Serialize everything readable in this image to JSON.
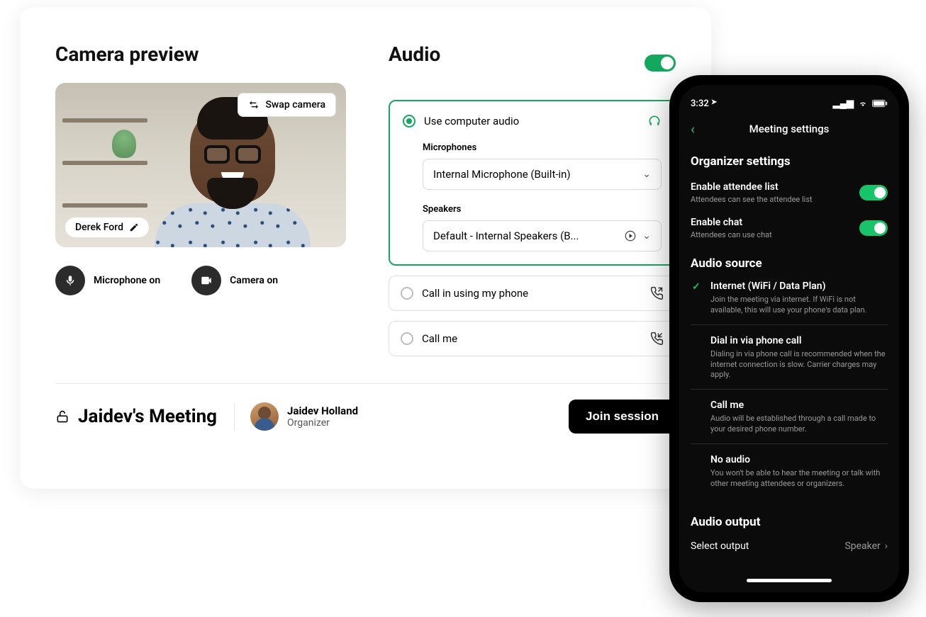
{
  "desktop": {
    "camera_title": "Camera preview",
    "swap_label": "Swap camera",
    "user_name": "Derek Ford",
    "mic_label": "Microphone on",
    "cam_label": "Camera on",
    "audio_title": "Audio",
    "use_computer_label": "Use computer audio",
    "mic_section": "Microphones",
    "mic_value": "Internal Microphone (Built-in)",
    "spk_section": "Speakers",
    "spk_value": "Default - Internal Speakers (B...",
    "call_in_label": "Call in using my phone",
    "call_me_label": "Call me",
    "meeting_name": "Jaidev's Meeting",
    "organizer_name": "Jaidev Holland",
    "organizer_role": "Organizer",
    "join_label": "Join session"
  },
  "phone": {
    "time": "3:32",
    "nav_title": "Meeting settings",
    "org_section": "Organizer settings",
    "toggles": [
      {
        "label": "Enable attendee list",
        "desc": "Attendees can see the attendee list"
      },
      {
        "label": "Enable chat",
        "desc": "Attendees can use chat"
      }
    ],
    "audio_source_title": "Audio source",
    "sources": [
      {
        "title": "Internet (WiFi / Data Plan)",
        "desc": "Join the meeting via internet. If WiFi is not available, this will use your phone's data plan."
      },
      {
        "title": "Dial in via phone call",
        "desc": "Dialing in via phone call is recommended when the internet connection is slow. Carrier charges may apply."
      },
      {
        "title": "Call me",
        "desc": "Audio will be established through a call made to your desired phone number."
      },
      {
        "title": "No audio",
        "desc": "You won't be able to hear the meeting or talk with other meeting attendees or organizers."
      }
    ],
    "audio_output_title": "Audio output",
    "output_label": "Select output",
    "output_value": "Speaker"
  }
}
